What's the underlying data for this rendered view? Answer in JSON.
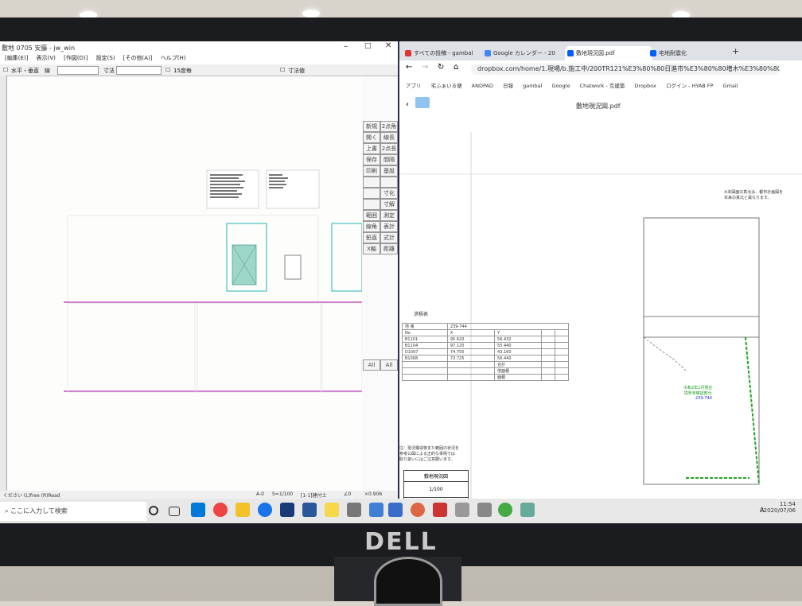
{
  "monitor": {
    "brand": "DELL"
  },
  "jw_window": {
    "title": "敷地 0705 安藤 - jw_win",
    "menus": [
      "[編集(E)]",
      "表示(V)",
      "[作図(D)]",
      "設定(S)",
      "[その他(A)]",
      "ヘルプ(H)"
    ],
    "toolbar": {
      "mode": "水平・垂直",
      "line_label": "線",
      "dim_label": "寸法",
      "deg15": "15度毎",
      "dim_value": "寸法値"
    },
    "right_buttons": [
      "新規",
      "開く",
      "上書",
      "保存",
      "印刷",
      "",
      "",
      "",
      "範囲",
      "線角",
      "鉛直",
      "X軸",
      "2点角",
      "線長",
      "2点長",
      "間隔",
      "基設",
      "",
      "寸化",
      "寸解",
      "測定",
      "表計",
      "式計",
      "距離"
    ],
    "status": [
      "ください (L)free (R)Read",
      "A-0",
      "S=1/100",
      "[1-1]建付土",
      "∠0",
      "×0.906"
    ],
    "all_left": "All",
    "all_right": "All"
  },
  "chrome": {
    "tabs": [
      {
        "label": "すべての投稿 - gambal",
        "color": "#d33"
      },
      {
        "label": "Google カレンダー - 20",
        "color": "#4285f4"
      },
      {
        "label": "敷地現況図.pdf",
        "color": "#0061ff"
      },
      {
        "label": "宅地耐震化",
        "color": "#0061ff"
      }
    ],
    "new_tab": "+",
    "url": "dropbox.com/home/1.現場/b.施工中/200TR121%E3%80%80日進市%E3%80%80増木%E3%80%80篠倖様/",
    "bookmarks": [
      "アプリ",
      "宅ふぁいる便",
      "ANDPAD",
      "日報",
      "gambal",
      "Google",
      "Chatwork - 互建築",
      "Dropbox",
      "ログイン - HYAB FP",
      "Gmail"
    ],
    "pdf_title": "敷地現況図.pdf"
  },
  "pdf": {
    "note": "※本図面の真北は、都市計画図を\n本来の真北と異なります。",
    "table_title": "求積表",
    "table_header": [
      "地 番",
      "239-744"
    ],
    "table_rows": [
      [
        "No",
        "X",
        "Y",
        "",
        ""
      ],
      [
        "B1101",
        "95.620",
        "56.432",
        "",
        ""
      ],
      [
        "B1104",
        "97.120",
        "55.440",
        "",
        ""
      ],
      [
        "D1007",
        "74.755",
        "43.160",
        "",
        ""
      ],
      [
        "B1008",
        "73.725",
        "56.440",
        "",
        ""
      ]
    ],
    "totals": [
      "合計",
      "倍面積",
      "面積"
    ],
    "left_caption_1": "注：現況構造物また範囲の状況を",
    "left_caption_2": "参考公図による正的な事柄では",
    "left_caption_3": "取り扱いにはご注意願います。",
    "stamp_title": "敷地現況図",
    "stamp_scale": "1/100",
    "green_label": "令和2年2月現在\n境界未確認部分",
    "green_value": "239-744"
  },
  "taskbar": {
    "search_placeholder": "ここに入力して検索",
    "time": "11:54",
    "date": "2020/07/06",
    "ime": "A"
  }
}
